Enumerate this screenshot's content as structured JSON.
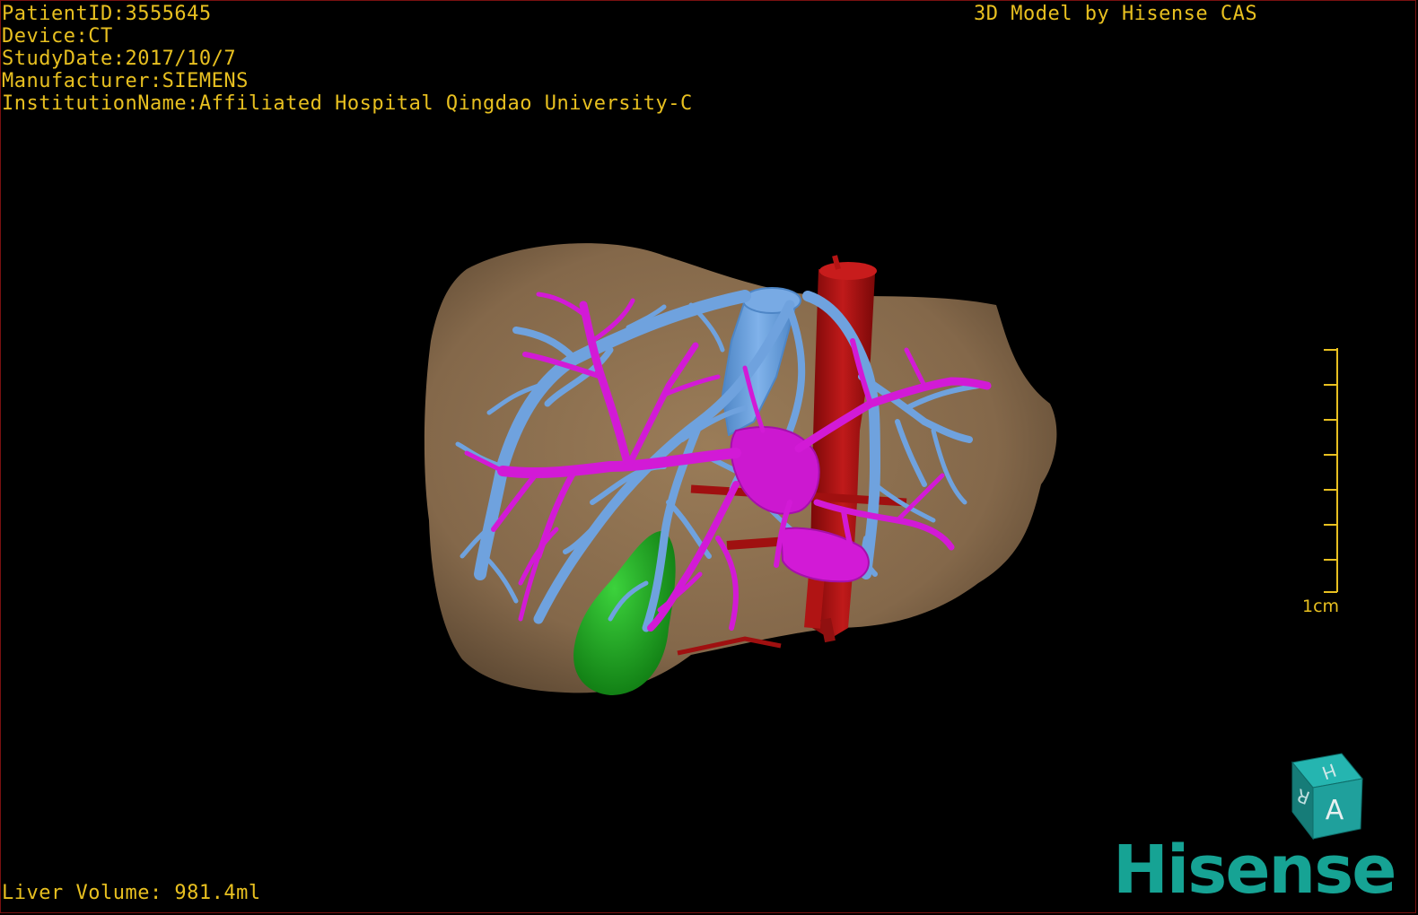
{
  "patient_info": {
    "patient_id": "PatientID:3555645",
    "device": "Device:CT",
    "study_date": "StudyDate:2017/10/7",
    "manufacturer": "Manufacturer:SIEMENS",
    "institution": "InstitutionName:Affiliated Hospital Qingdao University-C"
  },
  "header": {
    "model_credit": "3D Model by Hisense CAS"
  },
  "footer": {
    "liver_volume": "Liver Volume: 981.4ml"
  },
  "scale_bar": {
    "label": "1cm",
    "color": "#e8c020"
  },
  "orientation_cube": {
    "face_front": "A",
    "face_top": "H",
    "face_side": "R",
    "color": "#1a8a86"
  },
  "brand": {
    "name": "Hisense",
    "color": "#16a394"
  },
  "model_colors": {
    "liver": "#8a6e4e",
    "hepatic_vein": "#6fa2de",
    "portal_vein": "#d21ad6",
    "ivc": "#a81212",
    "gallbladder": "#1fa21f"
  },
  "text_color": "#e8c020"
}
